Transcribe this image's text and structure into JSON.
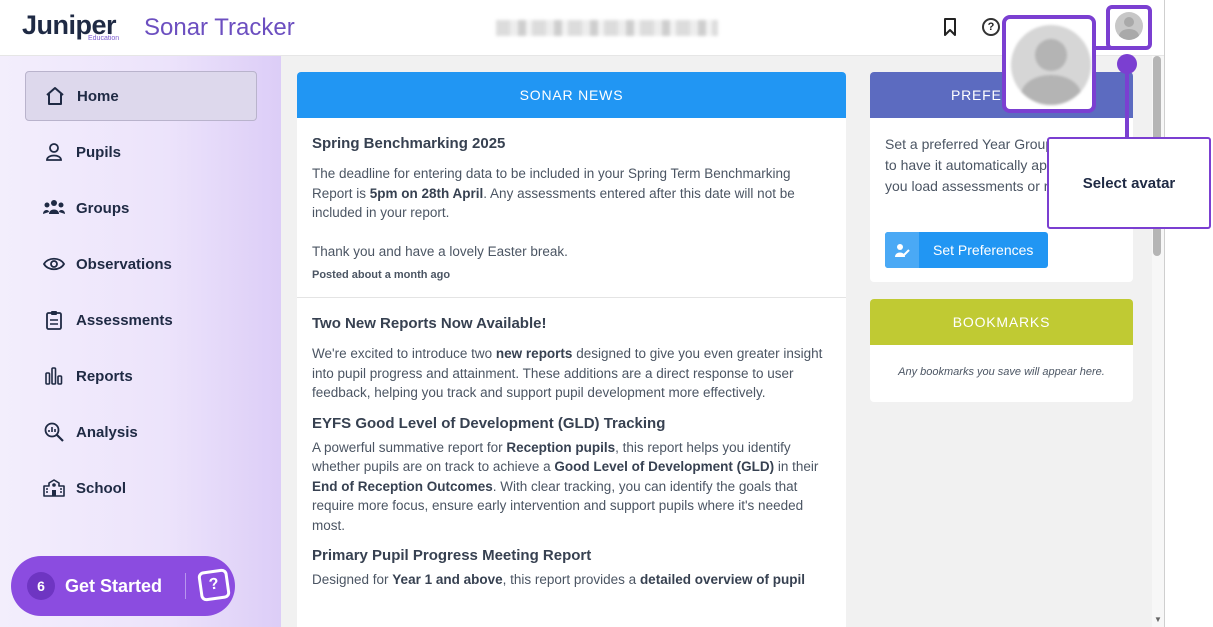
{
  "header": {
    "logo": "Juniper",
    "logo_sub": "Education",
    "product": "Sonar Tracker",
    "school_name_redacted": ""
  },
  "icons": {
    "bookmark": "bookmark-icon",
    "help": "help-icon",
    "avatar": "avatar-icon"
  },
  "sidebar": {
    "items": [
      {
        "label": "Home",
        "icon": "home-icon",
        "glyph": "⌂",
        "active": true
      },
      {
        "label": "Pupils",
        "icon": "person-icon",
        "glyph": "👤",
        "active": false
      },
      {
        "label": "Groups",
        "icon": "group-icon",
        "glyph": "👥",
        "active": false
      },
      {
        "label": "Observations",
        "icon": "eye-icon",
        "glyph": "👁",
        "active": false
      },
      {
        "label": "Assessments",
        "icon": "clipboard-icon",
        "glyph": "📋",
        "active": false
      },
      {
        "label": "Reports",
        "icon": "bar-chart-icon",
        "glyph": "📊",
        "active": false
      },
      {
        "label": "Analysis",
        "icon": "magnifier-chart-icon",
        "glyph": "🔍",
        "active": false
      },
      {
        "label": "School",
        "icon": "school-icon",
        "glyph": "🏫",
        "active": false
      }
    ],
    "get_started": {
      "count": "6",
      "label": "Get Started"
    }
  },
  "news": {
    "heading": "SONAR NEWS",
    "post1": {
      "title": "Spring Benchmarking 2025",
      "p1_a": "The deadline for entering data to be included in your Spring Term Benchmarking Report is ",
      "p1_b": "5pm on 28th April",
      "p1_c": ". Any assessments entered after this date will not be included in your report.",
      "p2": "Thank you and have a lovely Easter break.",
      "posted": "Posted about a month ago"
    },
    "post2": {
      "title": "Two New Reports Now Available!",
      "p1_a": "We're excited to introduce two ",
      "p1_b": "new reports",
      "p1_c": " designed to give you even greater insight into pupil progress and attainment. These additions are a direct response to user feedback, helping you track and support pupil development more effectively.",
      "sub1": "EYFS Good Level of Development (GLD) Tracking",
      "p2_a": "A powerful summative report for ",
      "p2_b": "Reception pupils",
      "p2_c": ", this report helps you identify whether pupils are on track to achieve a ",
      "p2_d": "Good Level of Development (GLD)",
      "p2_e": " in their ",
      "p2_f": "End of Reception Outcomes",
      "p2_g": ". With clear tracking, you can identify the goals that require more focus, ensure early intervention and support pupils where it's needed most.",
      "sub2": "Primary Pupil Progress Meeting Report",
      "p3_a": "Designed for ",
      "p3_b": "Year 1 and above",
      "p3_c": ", this report provides a ",
      "p3_d": "detailed overview of pupil"
    }
  },
  "preferences": {
    "heading": "PREFER",
    "text": "Set a preferred Year Group or Class to have it automatically applied when you load assessments or reports",
    "button": "Set Preferences"
  },
  "bookmarks": {
    "heading": "BOOKMARKS",
    "empty": "Any bookmarks you save will appear here."
  },
  "tutorial": {
    "tip": "Select avatar"
  },
  "colors": {
    "news_header": "#2196f3",
    "pref_header": "#5c6bc0",
    "bookmarks_header": "#c0ca33",
    "accent_purple": "#7b3fd1",
    "get_started": "#8b4ce0"
  }
}
